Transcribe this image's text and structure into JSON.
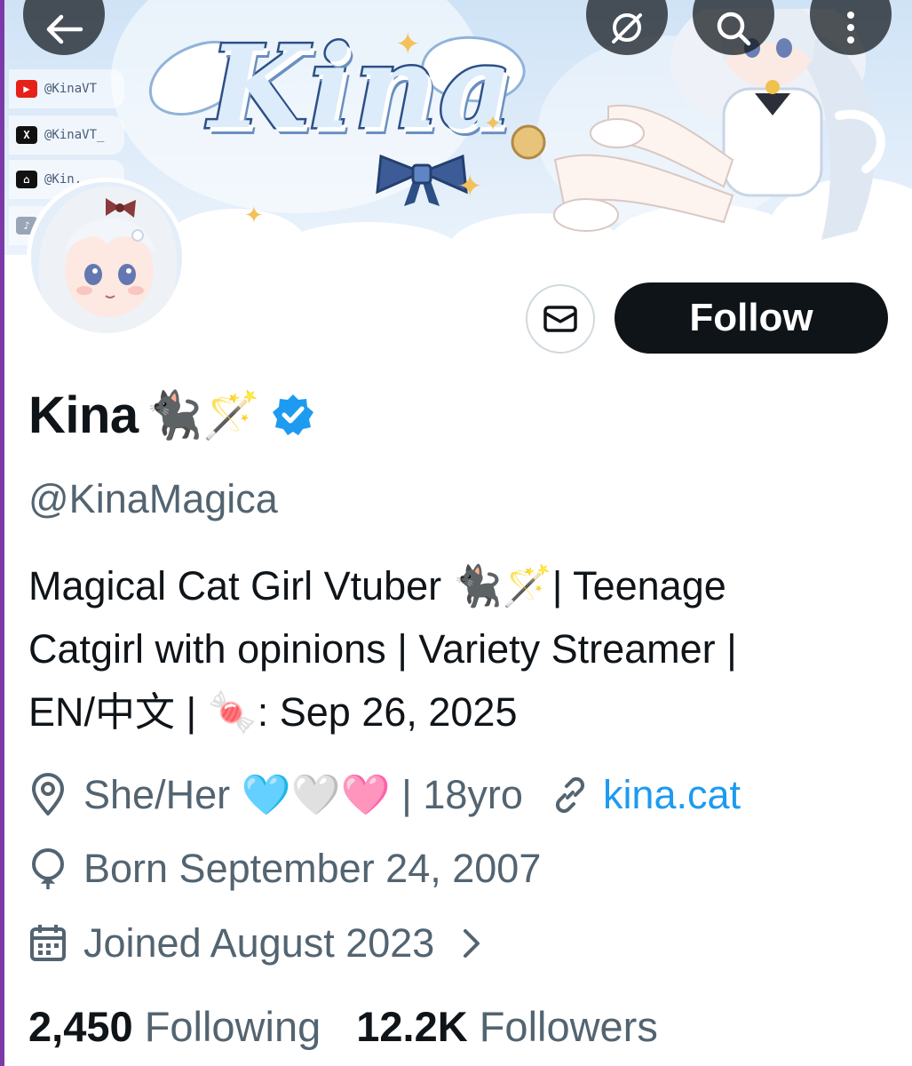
{
  "banner": {
    "logo_text": "Kina",
    "social_links": [
      {
        "platform_icon": "youtube-icon",
        "label": "@KinaVT"
      },
      {
        "platform_icon": "x-icon",
        "label": "@KinaVT_"
      },
      {
        "platform_icon": "twitch-icon",
        "label": "@Kin..."
      },
      {
        "platform_icon": "tiktok-icon",
        "label": ""
      }
    ]
  },
  "nav": {
    "back_icon": "arrow-left-icon",
    "grok_icon": "grok-icon",
    "search_icon": "search-icon",
    "more_icon": "more-vertical-icon"
  },
  "actions": {
    "message_icon": "envelope-icon",
    "follow_label": "Follow"
  },
  "profile": {
    "display_name": "Kina",
    "name_emoji": "🐈‍⬛🪄",
    "verified_icon": "verified-badge-icon",
    "handle": "@KinaMagica",
    "bio_lines": [
      "Magical Cat Girl Vtuber 🐈‍⬛🪄| Teenage",
      "Catgirl with opinions | Variety Streamer |",
      "EN/中文 | 🍬: Sep 26, 2025"
    ],
    "location": "She/Her 🩵🤍🩷 | 18yro",
    "website": "kina.cat",
    "birthday": "Born September 24, 2007",
    "joined": "Joined August 2023"
  },
  "stats": {
    "following_count": "2,450",
    "following_label": "Following",
    "followers_count": "12.2K",
    "followers_label": "Followers"
  },
  "colors": {
    "accent_blue": "#1d9bf0",
    "follow_button": "#0f1419",
    "muted_text": "#536471"
  }
}
